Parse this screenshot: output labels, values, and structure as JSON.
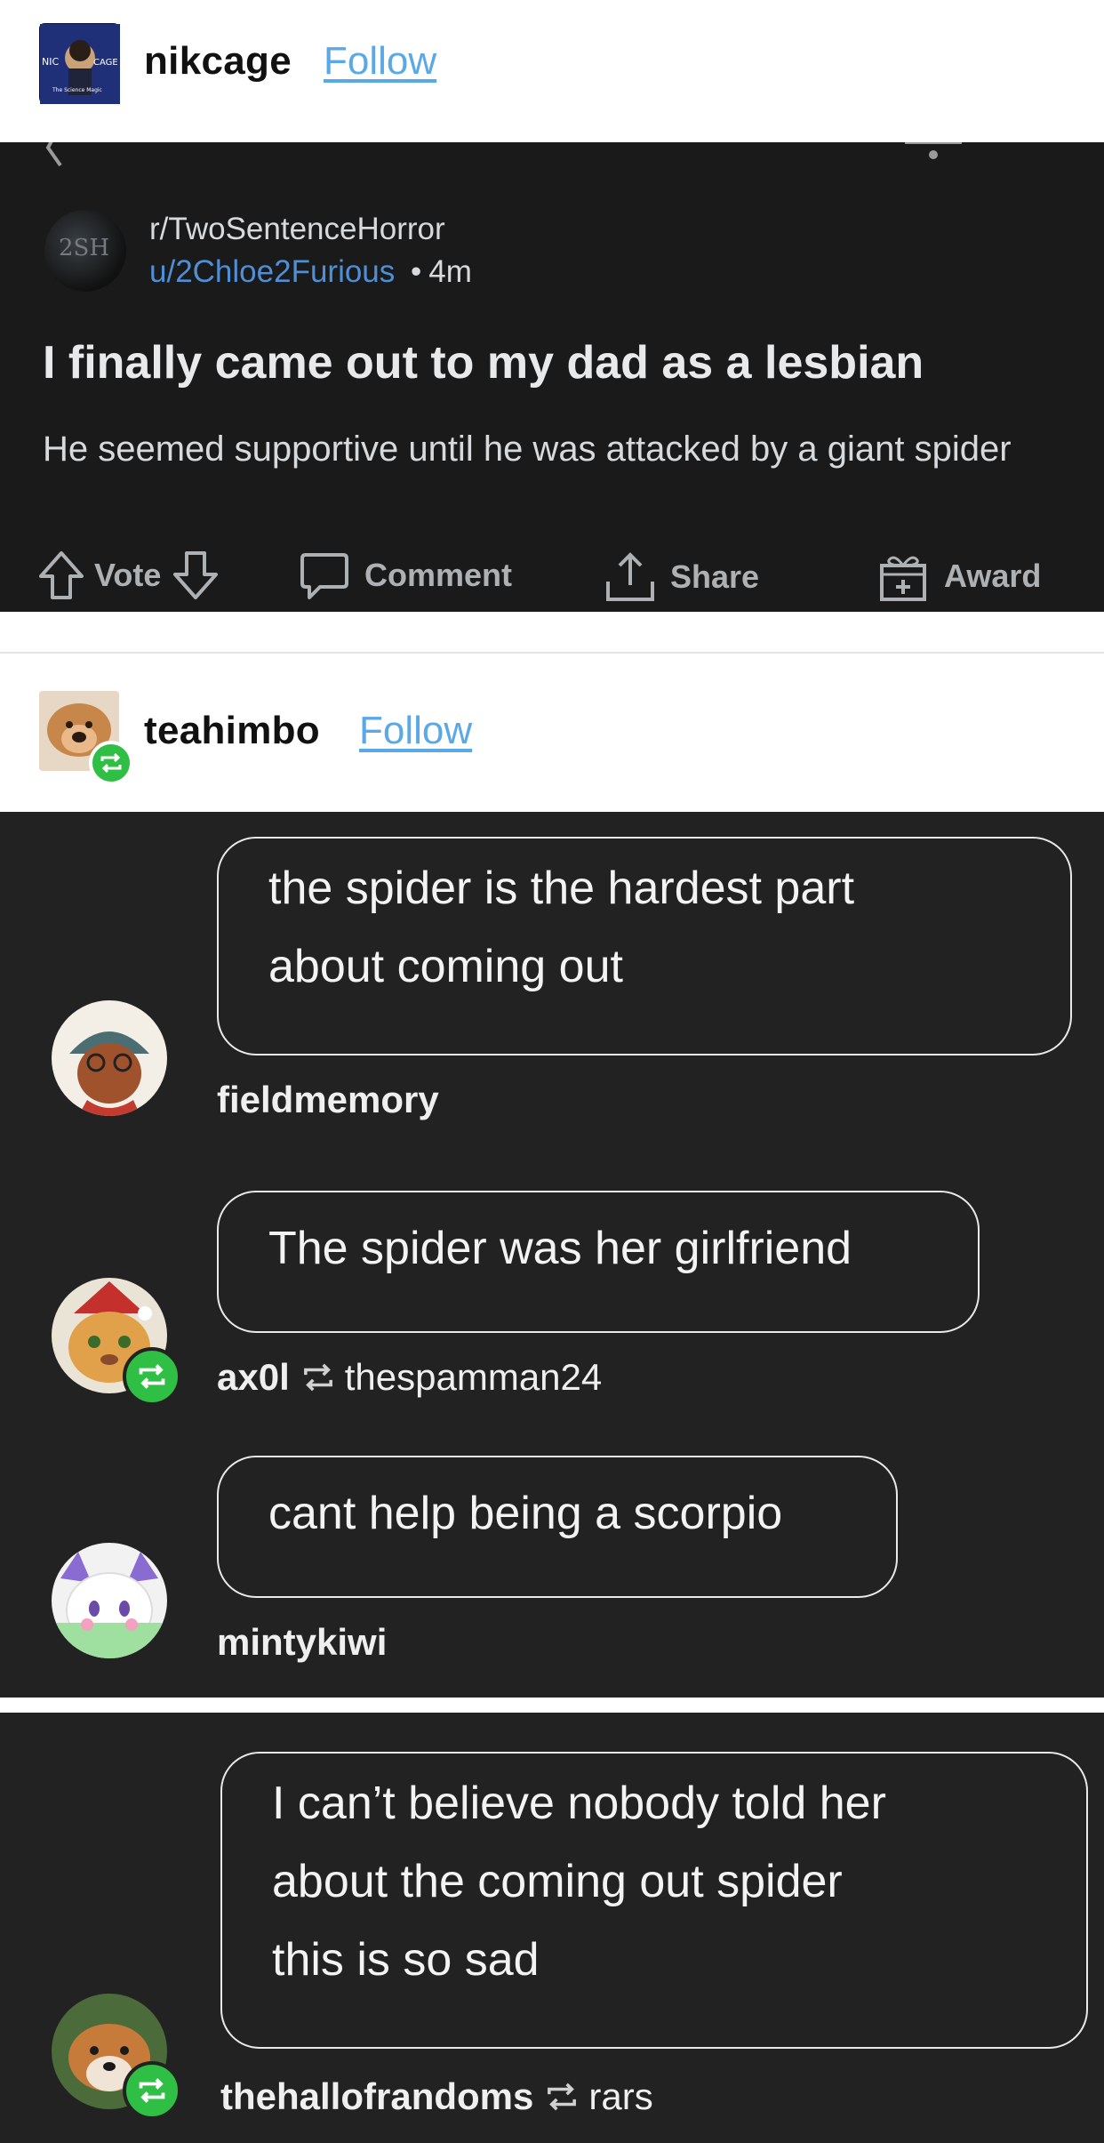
{
  "post1": {
    "username": "nikcage",
    "follow_label": "Follow",
    "avatar_text_left": "NIC",
    "avatar_text_right": "CAGE",
    "avatar_text_bottom": "The Science Magic"
  },
  "reddit": {
    "subreddit": "r/TwoSentenceHorror",
    "user": "u/2Chloe2Furious",
    "separator": "•",
    "time": "4m",
    "avatar_text": "2SH",
    "title": "I finally came out to my dad as a lesbian",
    "body": "He seemed supportive until he was attacked by a giant spider",
    "actions": {
      "vote": "Vote",
      "comment": "Comment",
      "share": "Share",
      "award": "Award"
    }
  },
  "post2": {
    "username": "teahimbo",
    "follow_label": "Follow"
  },
  "chat1": [
    {
      "text_line1": "the spider is the hardest part",
      "text_line2": "about coming out",
      "user": "fieldmemory"
    },
    {
      "text_line1": "The spider was her girlfriend",
      "user": "ax0l",
      "reblogged_from": "thespamman24"
    },
    {
      "text_line1": "cant help being a scorpio",
      "user": "mintykiwi"
    }
  ],
  "chat2": [
    {
      "text_line1": "I can’t believe nobody told her",
      "text_line2": "about the coming out spider",
      "text_line3": "this is so sad",
      "user": "thehallofrandoms",
      "reblogged_from": "rars"
    }
  ],
  "colors": {
    "follow": "#5aa9e6",
    "reblog_green": "#2fbf44",
    "reddit_bg": "#1a1a1b",
    "panel_bg": "#222222",
    "reddit_user_link": "#4f8fd6"
  }
}
